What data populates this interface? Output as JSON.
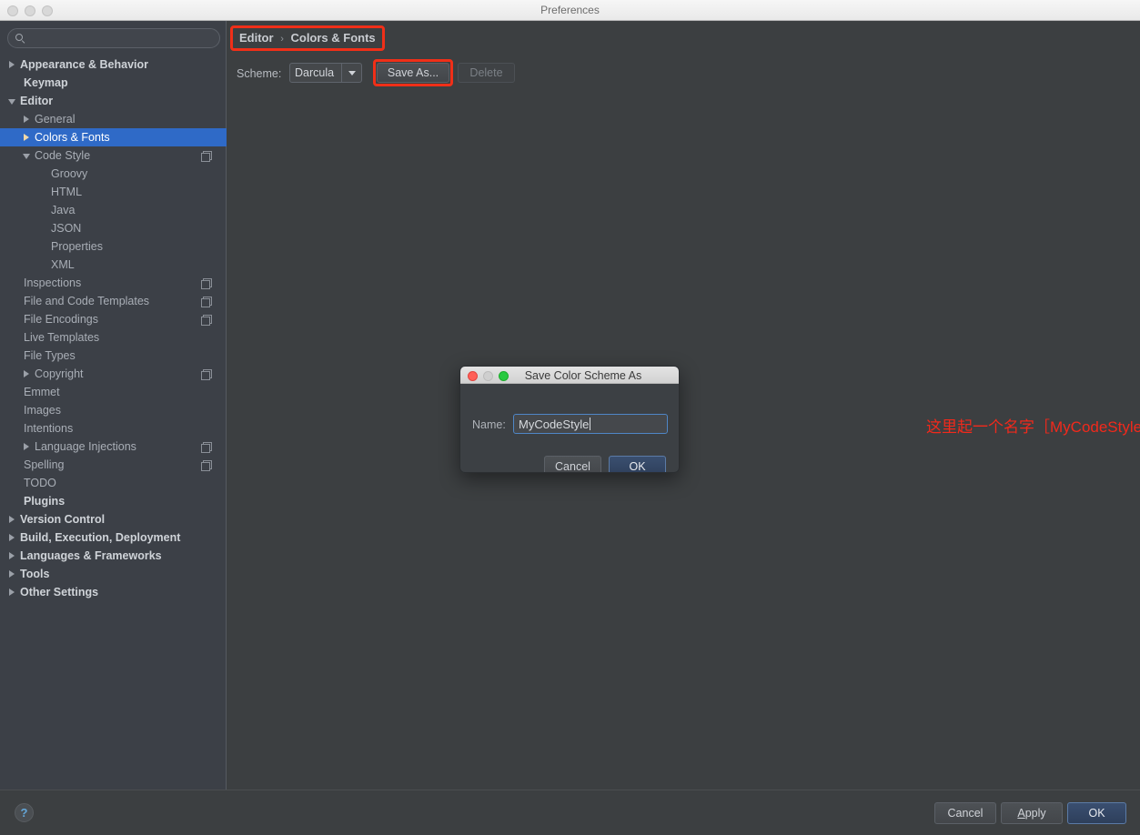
{
  "window": {
    "title": "Preferences",
    "traffic_lights": [
      "close-inactive",
      "minimize-inactive",
      "maximize-inactive"
    ]
  },
  "search": {
    "value": "",
    "placeholder": "",
    "icon": "search-icon"
  },
  "sidebar": {
    "items": [
      {
        "label": "Appearance & Behavior",
        "level": 0,
        "twisty": "closed",
        "bold": true,
        "selected": false,
        "copy": false
      },
      {
        "label": "Keymap",
        "level": 1,
        "twisty": "none",
        "bold": true,
        "selected": false,
        "copy": false
      },
      {
        "label": "Editor",
        "level": 0,
        "twisty": "open",
        "bold": true,
        "selected": false,
        "copy": false
      },
      {
        "label": "General",
        "level": 1,
        "twisty": "closed",
        "bold": false,
        "selected": false,
        "copy": false
      },
      {
        "label": "Colors & Fonts",
        "level": 1,
        "twisty": "closed",
        "bold": false,
        "selected": true,
        "copy": false
      },
      {
        "label": "Code Style",
        "level": 1,
        "twisty": "open",
        "bold": false,
        "selected": false,
        "copy": true
      },
      {
        "label": "Groovy",
        "level": 2,
        "twisty": "none",
        "bold": false,
        "selected": false,
        "copy": false
      },
      {
        "label": "HTML",
        "level": 2,
        "twisty": "none",
        "bold": false,
        "selected": false,
        "copy": false
      },
      {
        "label": "Java",
        "level": 2,
        "twisty": "none",
        "bold": false,
        "selected": false,
        "copy": false
      },
      {
        "label": "JSON",
        "level": 2,
        "twisty": "none",
        "bold": false,
        "selected": false,
        "copy": false
      },
      {
        "label": "Properties",
        "level": 2,
        "twisty": "none",
        "bold": false,
        "selected": false,
        "copy": false
      },
      {
        "label": "XML",
        "level": 2,
        "twisty": "none",
        "bold": false,
        "selected": false,
        "copy": false
      },
      {
        "label": "Inspections",
        "level": 1,
        "twisty": "none",
        "bold": false,
        "selected": false,
        "copy": true
      },
      {
        "label": "File and Code Templates",
        "level": 1,
        "twisty": "none",
        "bold": false,
        "selected": false,
        "copy": true
      },
      {
        "label": "File Encodings",
        "level": 1,
        "twisty": "none",
        "bold": false,
        "selected": false,
        "copy": true
      },
      {
        "label": "Live Templates",
        "level": 1,
        "twisty": "none",
        "bold": false,
        "selected": false,
        "copy": false
      },
      {
        "label": "File Types",
        "level": 1,
        "twisty": "none",
        "bold": false,
        "selected": false,
        "copy": false
      },
      {
        "label": "Copyright",
        "level": 1,
        "twisty": "closed",
        "bold": false,
        "selected": false,
        "copy": true
      },
      {
        "label": "Emmet",
        "level": 1,
        "twisty": "none",
        "bold": false,
        "selected": false,
        "copy": false
      },
      {
        "label": "Images",
        "level": 1,
        "twisty": "none",
        "bold": false,
        "selected": false,
        "copy": false
      },
      {
        "label": "Intentions",
        "level": 1,
        "twisty": "none",
        "bold": false,
        "selected": false,
        "copy": false
      },
      {
        "label": "Language Injections",
        "level": 1,
        "twisty": "closed",
        "bold": false,
        "selected": false,
        "copy": true
      },
      {
        "label": "Spelling",
        "level": 1,
        "twisty": "none",
        "bold": false,
        "selected": false,
        "copy": true
      },
      {
        "label": "TODO",
        "level": 1,
        "twisty": "none",
        "bold": false,
        "selected": false,
        "copy": false
      },
      {
        "label": "Plugins",
        "level": 1,
        "twisty": "none",
        "bold": true,
        "selected": false,
        "copy": false
      },
      {
        "label": "Version Control",
        "level": 0,
        "twisty": "closed",
        "bold": true,
        "selected": false,
        "copy": false
      },
      {
        "label": "Build, Execution, Deployment",
        "level": 0,
        "twisty": "closed",
        "bold": true,
        "selected": false,
        "copy": false
      },
      {
        "label": "Languages & Frameworks",
        "level": 0,
        "twisty": "closed",
        "bold": true,
        "selected": false,
        "copy": false
      },
      {
        "label": "Tools",
        "level": 0,
        "twisty": "closed",
        "bold": true,
        "selected": false,
        "copy": false
      },
      {
        "label": "Other Settings",
        "level": 0,
        "twisty": "closed",
        "bold": true,
        "selected": false,
        "copy": false
      }
    ]
  },
  "breadcrumb": {
    "parent": "Editor",
    "separator": "›",
    "current": "Colors & Fonts"
  },
  "scheme_row": {
    "label": "Scheme:",
    "selected_scheme": "Darcula",
    "options": [
      "Darcula"
    ],
    "save_as_label": "Save As...",
    "delete_label": "Delete",
    "delete_disabled": true
  },
  "annotation": {
    "text": "这里起一个名字［MyCodeStyle］，然后点击OK",
    "color": "#f2291b"
  },
  "dialog": {
    "title": "Save Color Scheme As",
    "traffic_lights": [
      "close-red",
      "minimize-gray",
      "maximize-green"
    ],
    "name_label": "Name:",
    "name_value": "MyCodeStyle",
    "name_placeholder": "",
    "cancel_label": "Cancel",
    "ok_label": "OK"
  },
  "bottom_bar": {
    "help_label": "?",
    "cancel_label": "Cancel",
    "apply_label": "Apply",
    "apply_mnemonic": "A",
    "apply_rest": "pply",
    "ok_label": "OK"
  },
  "colors": {
    "accent_selection": "#2f6ac7",
    "annotation_red": "#f2291b",
    "highlight_box_red": "#f02f18",
    "sidebar_bg": "#3c4047",
    "content_bg": "#3c3f41",
    "default_button_blue": "#3a4f70"
  }
}
